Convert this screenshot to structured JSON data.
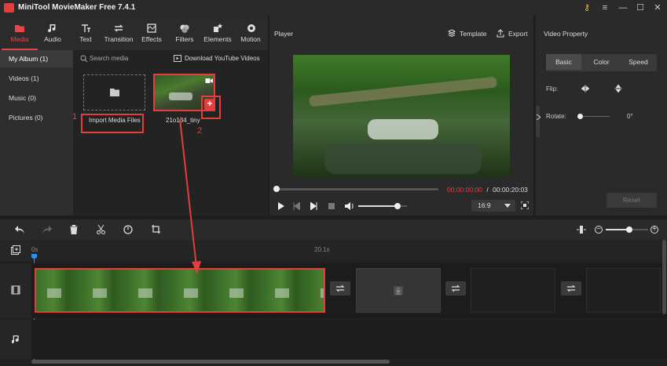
{
  "app": {
    "title": "MiniTool MovieMaker Free 7.4.1"
  },
  "nav": [
    {
      "label": "Media",
      "icon": "folder-icon",
      "active": true
    },
    {
      "label": "Audio",
      "icon": "music-note-icon"
    },
    {
      "label": "Text",
      "icon": "text-icon"
    },
    {
      "label": "Transition",
      "icon": "transition-icon"
    },
    {
      "label": "Effects",
      "icon": "effects-icon"
    },
    {
      "label": "Filters",
      "icon": "filters-icon"
    },
    {
      "label": "Elements",
      "icon": "elements-icon"
    },
    {
      "label": "Motion",
      "icon": "motion-icon"
    }
  ],
  "sidebar": [
    {
      "label": "My Album (1)",
      "active": true
    },
    {
      "label": "Videos (1)"
    },
    {
      "label": "Music (0)"
    },
    {
      "label": "Pictures (0)"
    }
  ],
  "media": {
    "search_placeholder": "Search media",
    "download_label": "Download YouTube Videos",
    "import_label": "Import Media Files",
    "clip_name": "21o134_tiny",
    "annotation_1": "1",
    "annotation_2": "2"
  },
  "player": {
    "title": "Player",
    "template_label": "Template",
    "export_label": "Export",
    "current_time": "00:00:00:00",
    "separator": " / ",
    "total_time": "00:00:20:03",
    "aspect": "16:9",
    "progress": 0.0,
    "volume": 0.8
  },
  "property": {
    "title": "Video Property",
    "tabs": [
      "Basic",
      "Color",
      "Speed"
    ],
    "active_tab": "Basic",
    "flip_label": "Flip:",
    "rotate_label": "Rotate:",
    "rotate_value": "0°",
    "reset_label": "Reset"
  },
  "timeline": {
    "ruler_start": "0s",
    "ruler_mid": "20.1s",
    "zoom": 0.55
  },
  "colors": {
    "accent": "#e53c3c",
    "panel": "#2a2a2a"
  }
}
